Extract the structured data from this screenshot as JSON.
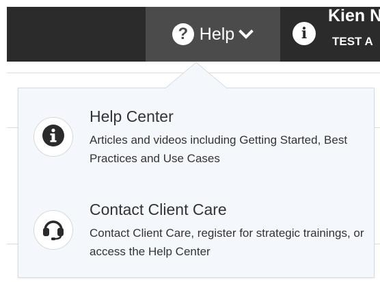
{
  "topbar": {
    "help_label": "Help",
    "help_icon": "question-circle-icon",
    "info_icon": "info-circle-icon",
    "user_name": "Kien N",
    "user_sub": "TEST A"
  },
  "help_menu": {
    "items": [
      {
        "title": "Help Center",
        "description": "Articles and videos including Getting Started, Best Practices and Use Cases",
        "icon": "info-circle-icon"
      },
      {
        "title": "Contact Client Care",
        "description": "Contact Client Care, register for strategic trainings, or access the Help Center",
        "icon": "headset-icon"
      }
    ]
  },
  "colors": {
    "topbar_bg": "#2b2b2b",
    "help_tab_bg": "#4b4b4b",
    "dropdown_bg": "#f4f7fc",
    "text": "#333333"
  }
}
